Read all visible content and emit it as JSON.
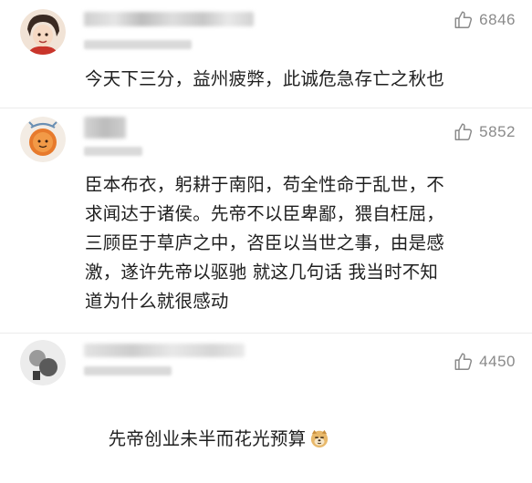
{
  "comments": [
    {
      "likes": "6846",
      "like_icon": "thumbs-up-outline-icon",
      "text": "今天下三分，益州疲弊，此诚危急存亡之秋也"
    },
    {
      "likes": "5852",
      "like_icon": "thumbs-up-outline-icon",
      "text": "臣本布衣，躬耕于南阳，苟全性命于乱世，不\n求闻达于诸侯。先帝不以臣卑鄙，猥自枉屈，\n三顾臣于草庐之中，咨臣以当世之事，由是感\n激，遂许先帝以驱驰 就这几句话 我当时不知\n道为什么就很感动"
    },
    {
      "likes": "4450",
      "like_icon": "thumbs-up-outline-icon",
      "text": "先帝创业未半而花光预算",
      "emoji": "doge-emoji"
    }
  ],
  "colors": {
    "text": "#1f1f1f",
    "like_count": "#8a8a8a",
    "divider": "#ececec"
  }
}
